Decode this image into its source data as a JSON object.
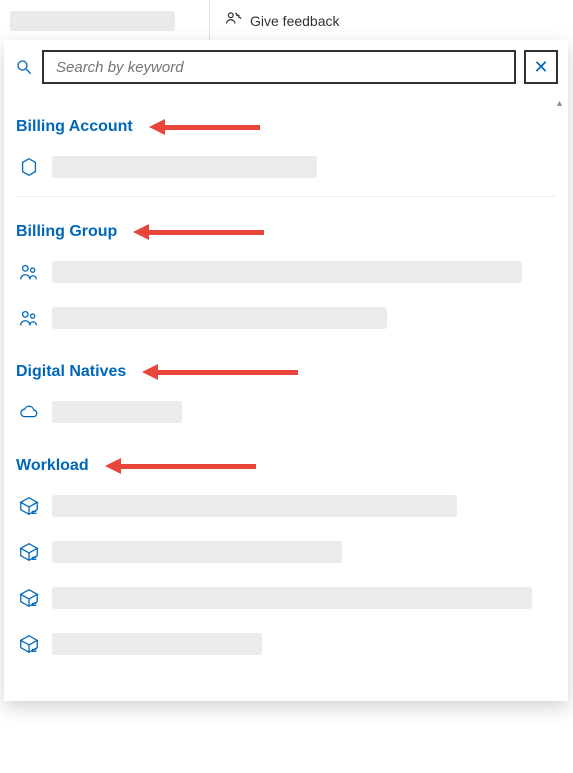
{
  "toolbar": {
    "feedback_label": "Give feedback"
  },
  "search": {
    "placeholder": "Search by keyword",
    "value": ""
  },
  "sections": {
    "billing_account": {
      "title": "Billing Account"
    },
    "billing_group": {
      "title": "Billing Group"
    },
    "digital_natives": {
      "title": "Digital Natives"
    },
    "workload": {
      "title": "Workload"
    }
  },
  "clear_icon_glyph": "✕",
  "scroll_cue_glyph": "▴"
}
